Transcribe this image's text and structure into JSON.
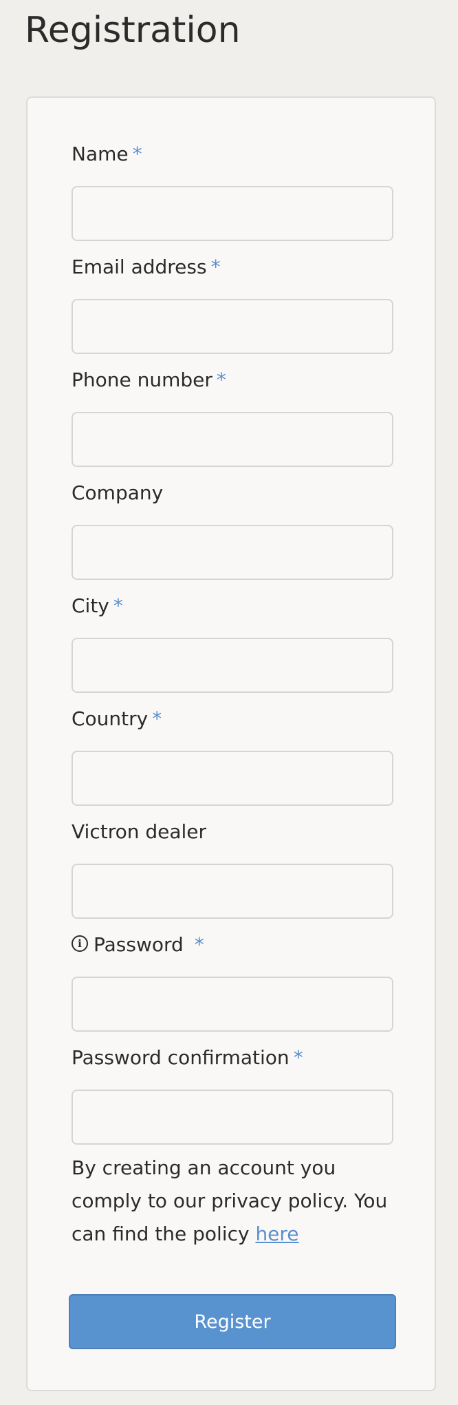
{
  "page": {
    "title": "Registration"
  },
  "form": {
    "required_marker": "*",
    "fields": [
      {
        "label": "Name",
        "required": true,
        "value": ""
      },
      {
        "label": "Email address",
        "required": true,
        "value": ""
      },
      {
        "label": "Phone number",
        "required": true,
        "value": ""
      },
      {
        "label": "Company",
        "required": false,
        "value": ""
      },
      {
        "label": "City",
        "required": true,
        "value": ""
      },
      {
        "label": "Country",
        "required": true,
        "value": ""
      },
      {
        "label": "Victron dealer",
        "required": false,
        "value": ""
      },
      {
        "label": "Password",
        "required": true,
        "value": "",
        "icon": "info-icon"
      },
      {
        "label": "Password confirmation",
        "required": true,
        "value": ""
      }
    ],
    "info_icon_glyph": "i",
    "privacy": {
      "text": "By creating an account you comply to our privacy policy. You can find the policy ",
      "link_text": "here"
    },
    "register_label": "Register"
  },
  "colors": {
    "accent": "#5893cf",
    "required_marker": "#5a8fcf",
    "background": "#f0efec",
    "card": "#f9f8f6"
  }
}
